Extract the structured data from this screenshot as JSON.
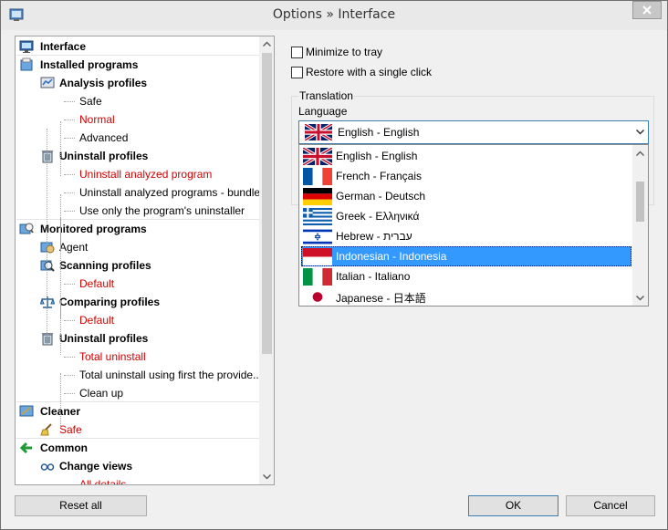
{
  "window": {
    "title": "Options » Interface"
  },
  "tree": {
    "nodes": [
      {
        "label": "Interface",
        "style": "bold",
        "icon": "monitor-icon"
      },
      {
        "label": "Installed programs",
        "style": "bold",
        "icon": "program-box-icon"
      },
      {
        "label": "Analysis profiles",
        "style": "bold",
        "icon": "analysis-icon"
      },
      {
        "label": "Safe",
        "style": "normal",
        "icon": ""
      },
      {
        "label": "Normal",
        "style": "red",
        "icon": ""
      },
      {
        "label": "Advanced",
        "style": "normal",
        "icon": ""
      },
      {
        "label": "Uninstall profiles",
        "style": "bold",
        "icon": "trash-icon"
      },
      {
        "label": "Uninstall analyzed program",
        "style": "red",
        "icon": ""
      },
      {
        "label": "Uninstall analyzed programs - bundle",
        "style": "normal",
        "icon": ""
      },
      {
        "label": "Use only the program's uninstaller",
        "style": "normal",
        "icon": ""
      },
      {
        "label": "Monitored programs",
        "style": "bold",
        "icon": "monitored-icon"
      },
      {
        "label": "Agent",
        "style": "normal",
        "icon": "agent-icon"
      },
      {
        "label": "Scanning profiles",
        "style": "bold",
        "icon": "magnifier-icon"
      },
      {
        "label": "Default",
        "style": "red",
        "icon": ""
      },
      {
        "label": "Comparing profiles",
        "style": "bold",
        "icon": "scales-icon"
      },
      {
        "label": "Default",
        "style": "red",
        "icon": ""
      },
      {
        "label": "Uninstall profiles",
        "style": "bold",
        "icon": "trash-icon"
      },
      {
        "label": "Total uninstall",
        "style": "red",
        "icon": ""
      },
      {
        "label": "Total uninstall using first the provide...",
        "style": "normal",
        "icon": ""
      },
      {
        "label": "Clean up",
        "style": "normal",
        "icon": ""
      },
      {
        "label": "Cleaner",
        "style": "bold",
        "icon": "cleaner-icon"
      },
      {
        "label": "Safe",
        "style": "red",
        "icon": "broom-icon"
      },
      {
        "label": "Common",
        "style": "bold",
        "icon": "green-arrow-icon"
      },
      {
        "label": "Change views",
        "style": "bold",
        "icon": "glasses-icon"
      },
      {
        "label": "All details",
        "style": "red",
        "icon": ""
      }
    ]
  },
  "options": {
    "minimize_to_tray": "Minimize to tray",
    "restore_single_click": "Restore with a single click"
  },
  "translation": {
    "group_title": "Translation",
    "language_label": "Language",
    "selected": "English - English",
    "languages": [
      {
        "label": "English - English",
        "flag": "uk-flag-icon"
      },
      {
        "label": "French - Français",
        "flag": "france-flag-icon"
      },
      {
        "label": "German - Deutsch",
        "flag": "germany-flag-icon"
      },
      {
        "label": "Greek - Ελληνικά",
        "flag": "greece-flag-icon"
      },
      {
        "label": "Hebrew - עברית",
        "flag": "israel-flag-icon"
      },
      {
        "label": "Indonesian - Indonesia",
        "flag": "indonesia-flag-icon"
      },
      {
        "label": "Italian - Italiano",
        "flag": "italy-flag-icon"
      },
      {
        "label": "Japanese - 日本語",
        "flag": "japan-flag-icon"
      }
    ],
    "highlighted": "Indonesian - Indonesia"
  },
  "buttons": {
    "reset_all": "Reset all",
    "ok": "OK",
    "cancel": "Cancel"
  },
  "colors": {
    "accent": "#3399ff",
    "red_text": "#d10000"
  }
}
